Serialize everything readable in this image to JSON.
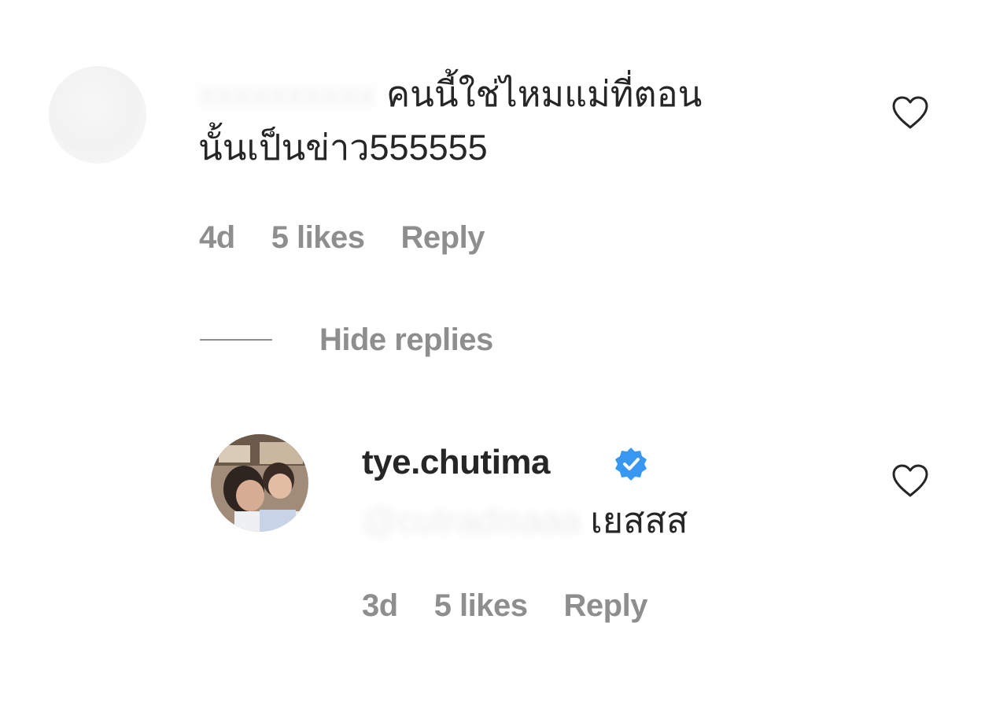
{
  "comment": {
    "author_blurred": "xxxxxxxxxx",
    "text_line1": "คนนี้ใช่ไหมแม่ที่ตอน",
    "text_line2": "นั้นเป็นข่าว555555",
    "age": "4d",
    "likes": "5 likes",
    "reply_label": "Reply",
    "heart_icon": "heart-outline-icon"
  },
  "replies_toggle": {
    "label": "Hide replies"
  },
  "reply": {
    "username": "tye.chutima",
    "verified_icon": "verified-badge-icon",
    "mention": "@cutradisaaa",
    "text": "เยสสส",
    "age": "3d",
    "likes": "5 likes",
    "reply_label": "Reply",
    "heart_icon": "heart-outline-icon"
  },
  "colors": {
    "text": "#262626",
    "muted": "#8e8e8e",
    "verified": "#3897f0"
  }
}
